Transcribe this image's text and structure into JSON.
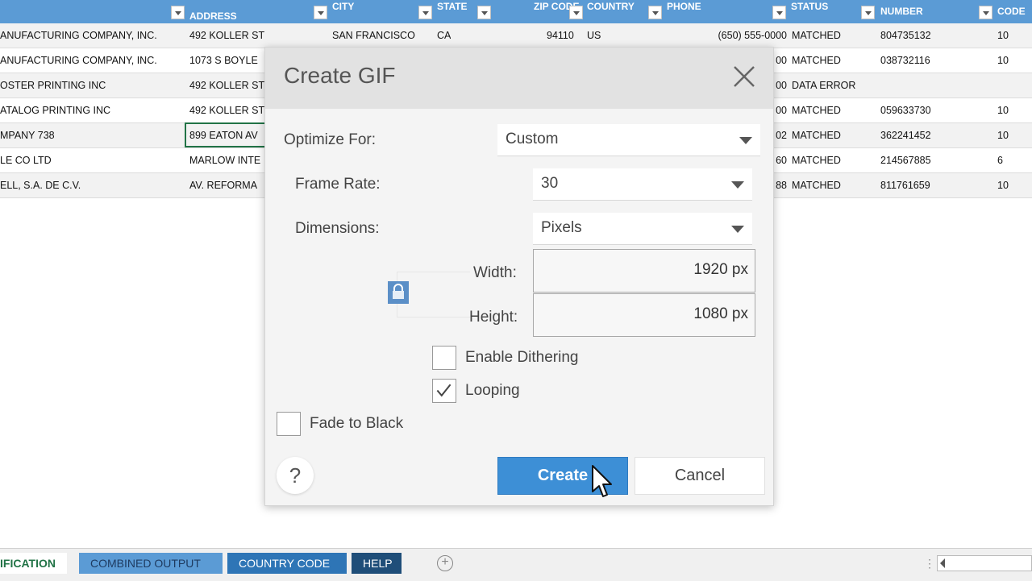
{
  "columns": [
    {
      "label": "ADDRESS"
    },
    {
      "label": "CITY"
    },
    {
      "label": "STATE"
    },
    {
      "label": "ZIP CODE"
    },
    {
      "label": "COUNTRY"
    },
    {
      "label": "PHONE"
    },
    {
      "label": "STATUS"
    },
    {
      "label": "NUMBER"
    },
    {
      "label": "CODE"
    }
  ],
  "rows": [
    {
      "name": "ANUFACTURING COMPANY, INC.",
      "address": "492 KOLLER ST",
      "city": "SAN FRANCISCO",
      "state": "CA",
      "zip": "94110",
      "country": "US",
      "phone": "(650) 555-0000",
      "status": "MATCHED",
      "number": "804735132",
      "code": "10"
    },
    {
      "name": "ANUFACTURING COMPANY, INC.",
      "address": "1073 S BOYLE",
      "city": "",
      "state": "",
      "zip": "",
      "country": "",
      "phone": "00",
      "status": "MATCHED",
      "number": "038732116",
      "code": "10"
    },
    {
      "name": "OSTER PRINTING INC",
      "address": "492 KOLLER ST",
      "city": "",
      "state": "",
      "zip": "",
      "country": "",
      "phone": "00",
      "status": "DATA ERROR",
      "number": "",
      "code": ""
    },
    {
      "name": "ATALOG PRINTING INC",
      "address": "492 KOLLER ST",
      "city": "",
      "state": "",
      "zip": "",
      "country": "",
      "phone": "00",
      "status": "MATCHED",
      "number": "059633730",
      "code": "10"
    },
    {
      "name": "MPANY 738",
      "address": "899 EATON AV",
      "city": "",
      "state": "",
      "zip": "",
      "country": "",
      "phone": "02",
      "status": "MATCHED",
      "number": "362241452",
      "code": "10"
    },
    {
      "name": "LE CO LTD",
      "address": "MARLOW INTE",
      "city": "",
      "state": "",
      "zip": "",
      "country": "",
      "phone": "60",
      "status": "MATCHED",
      "number": "214567885",
      "code": "6"
    },
    {
      "name": "ELL, S.A. DE C.V.",
      "address": "AV. REFORMA",
      "city": "",
      "state": "",
      "zip": "",
      "country": "",
      "phone": "88",
      "status": "MATCHED",
      "number": "811761659",
      "code": "10"
    }
  ],
  "sheet_tabs": {
    "active": "IFICATION",
    "combined": "COMBINED OUTPUT",
    "country": "COUNTRY CODE",
    "help": "HELP"
  },
  "dialog": {
    "title": "Create GIF",
    "optimize_label": "Optimize For:",
    "optimize_value": "Custom",
    "frame_rate_label": "Frame Rate:",
    "frame_rate_value": "30",
    "dimensions_label": "Dimensions:",
    "dimensions_value": "Pixels",
    "width_label": "Width:",
    "width_value": "1920 px",
    "height_label": "Height:",
    "height_value": "1080 px",
    "dithering_label": "Enable Dithering",
    "dithering_checked": false,
    "looping_label": "Looping",
    "looping_checked": true,
    "fade_label": "Fade to Black",
    "fade_checked": false,
    "help_glyph": "?",
    "create_label": "Create",
    "cancel_label": "Cancel"
  },
  "colors": {
    "header_blue": "#5b9bd5",
    "create_button": "#3d8fd6",
    "active_tab_text": "#217346"
  }
}
